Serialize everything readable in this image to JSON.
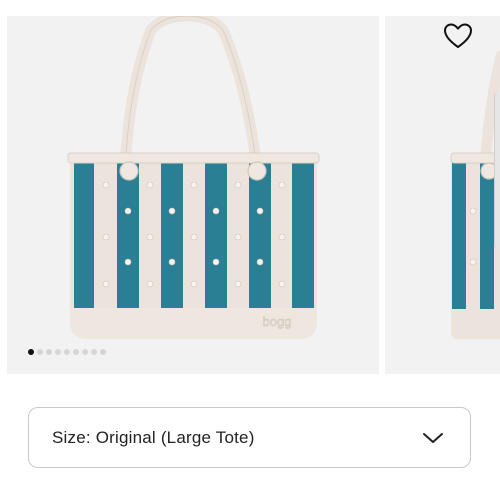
{
  "gallery": {
    "image_count": 9,
    "active_index": 0,
    "product_image": "striped-tote-bag",
    "logo_text": "bogg",
    "colors": {
      "stripe": "#2a7f95",
      "bag": "#ece4dc",
      "background": "#f2f2f2"
    }
  },
  "favorite": {
    "icon": "heart-outline"
  },
  "size_selector": {
    "label": "Size: Original (Large Tote)",
    "icon": "chevron-down"
  }
}
